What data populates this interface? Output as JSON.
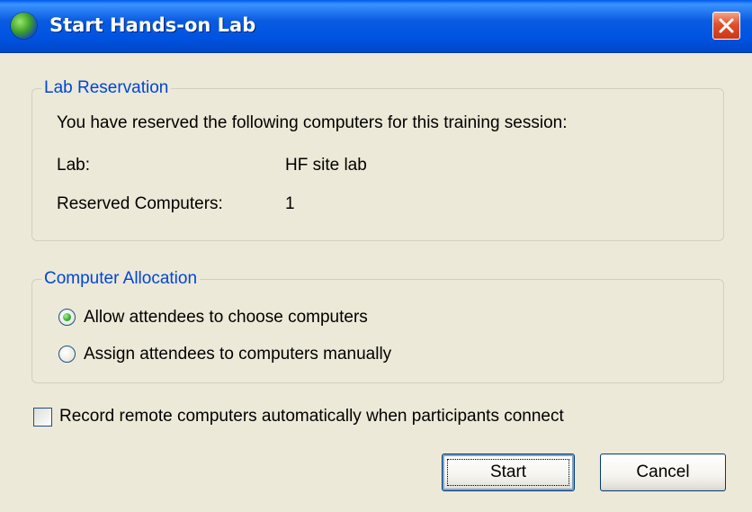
{
  "window": {
    "title": "Start Hands-on Lab",
    "icon": "globe-icon",
    "close_icon": "close-icon"
  },
  "lab_reservation": {
    "legend": "Lab Reservation",
    "intro": "You have reserved the following computers for this training session:",
    "lab_label": "Lab:",
    "lab_value": "HF site lab",
    "reserved_label": "Reserved Computers:",
    "reserved_value": "1"
  },
  "computer_allocation": {
    "legend": "Computer Allocation",
    "options": [
      {
        "label": "Allow attendees to choose computers",
        "selected": true
      },
      {
        "label": "Assign attendees to computers manually",
        "selected": false
      }
    ]
  },
  "record_option": {
    "label": "Record remote computers automatically when participants connect",
    "checked": false
  },
  "buttons": {
    "start": "Start",
    "cancel": "Cancel"
  },
  "colors": {
    "titlebar": "#0054E3",
    "dialog_bg": "#ECE9D8",
    "group_legend": "#0046D5",
    "close_button": "#E0502B"
  }
}
